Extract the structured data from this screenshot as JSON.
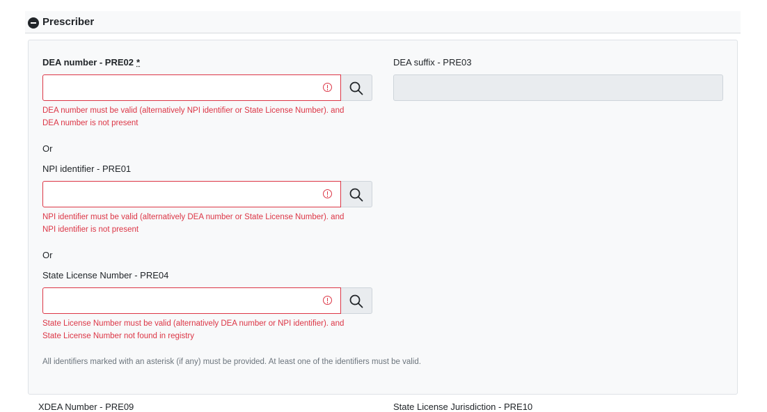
{
  "section": {
    "title": "Prescriber"
  },
  "fields": {
    "dea": {
      "label": "DEA number - PRE02",
      "required_mark": "*",
      "value": "",
      "error_line1": "DEA number must be valid (alternatively NPI identifier or State License Number). and",
      "error_line2": "DEA number is not present"
    },
    "dea_suffix": {
      "label": "DEA suffix - PRE03",
      "value": ""
    },
    "npi": {
      "label": "NPI identifier - PRE01",
      "value": "",
      "error_line1": "NPI identifier must be valid (alternatively DEA number or State License Number). and",
      "error_line2": "NPI identifier is not present"
    },
    "state_license": {
      "label": "State License Number - PRE04",
      "value": "",
      "error_line1": "State License Number must be valid (alternatively DEA number or NPI identifier). and",
      "error_line2": "State License Number not found in registry"
    }
  },
  "separators": {
    "or1": "Or",
    "or2": "Or"
  },
  "hint": "All identifiers marked with an asterisk (if any) must be provided. At least one of the identifiers must be valid.",
  "below": {
    "left_label": "XDEA Number - PRE09",
    "right_label": "State License Jurisdiction - PRE10"
  },
  "colors": {
    "error": "#dc3545",
    "panel_bg": "#f8f9fa",
    "button_bg": "#e9ecef"
  },
  "icons": {
    "collapse": "minus-circle-icon",
    "search": "search-icon",
    "error": "exclamation-circle-icon"
  }
}
